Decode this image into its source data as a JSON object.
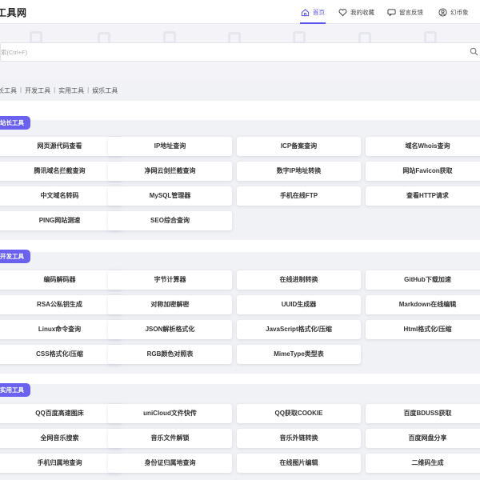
{
  "header": {
    "logo": "工具网",
    "nav": [
      {
        "label": "首页",
        "icon": "home-icon"
      },
      {
        "label": "我的收藏",
        "icon": "heart-icon"
      },
      {
        "label": "留言反馈",
        "icon": "chat-icon"
      },
      {
        "label": "幻币象",
        "icon": "user-icon"
      }
    ]
  },
  "search": {
    "placeholder": "索(Ctrl+F)"
  },
  "breadcrumb": [
    "长工具",
    "开发工具",
    "实用工具",
    "娱乐工具"
  ],
  "sections": [
    {
      "title": "站长工具",
      "items": [
        "网页源代码查看",
        "IP地址查询",
        "ICP备案查询",
        "域名Whois查询",
        "腾讯域名拦截查询",
        "净网云剑拦截查询",
        "数字IP地址转换",
        "网站Favicon获取",
        "中文域名转码",
        "MySQL管理器",
        "手机在线FTP",
        "查看HTTP请求",
        "PING网站测速",
        "SEO综合查询"
      ]
    },
    {
      "title": "开发工具",
      "items": [
        "编码解码器",
        "字节计算器",
        "在线进制转换",
        "GitHub下载加速",
        "RSA公私钥生成",
        "对称加密解密",
        "UUID生成器",
        "Markdown在线编辑",
        "Linux命令查询",
        "JSON解析格式化",
        "JavaScript格式化/压缩",
        "Html格式化/压缩",
        "CSS格式化/压缩",
        "RGB颜色对照表",
        "MimeType类型表"
      ]
    },
    {
      "title": "实用工具",
      "items": [
        "QQ百度高速图床",
        "uniCloud文件快传",
        "QQ获取COOKIE",
        "百度BDUSS获取",
        "全网音乐搜索",
        "音乐文件解锁",
        "音乐外链转换",
        "百度网盘分享",
        "手机归属地查询",
        "身份证归属地查询",
        "在线图片编辑",
        "二维码生成"
      ]
    }
  ],
  "colors": {
    "accent": "#5a53f2",
    "tag": "#6b61f0"
  }
}
